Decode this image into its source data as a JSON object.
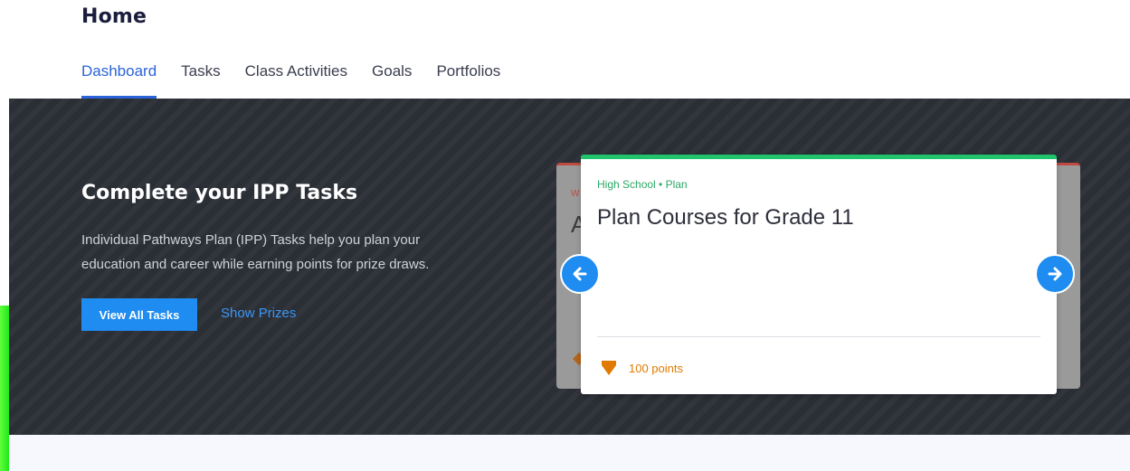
{
  "header": {
    "title": "Home"
  },
  "tabs": [
    {
      "label": "Dashboard",
      "active": true
    },
    {
      "label": "Tasks",
      "active": false
    },
    {
      "label": "Class Activities",
      "active": false
    },
    {
      "label": "Goals",
      "active": false
    },
    {
      "label": "Portfolios",
      "active": false
    }
  ],
  "hero": {
    "heading": "Complete your IPP Tasks",
    "description": "Individual Pathways Plan (IPP) Tasks help you plan your education and career while earning points for prize draws.",
    "primary_button": "View All Tasks",
    "secondary_link": "Show Prizes"
  },
  "carousel": {
    "back_card": {
      "category_fragment": "W",
      "title_fragment": "A"
    },
    "card": {
      "category": "High School • Plan",
      "title": "Plan Courses for Grade 11",
      "points": "100 points"
    },
    "prev_icon": "arrow-left-icon",
    "next_icon": "arrow-right-icon"
  },
  "colors": {
    "accent": "#2b63d8",
    "button": "#1e8cf0",
    "hero_bg": "#2a2e35",
    "card_accent": "#1fc46c",
    "points": "#e07b00"
  }
}
